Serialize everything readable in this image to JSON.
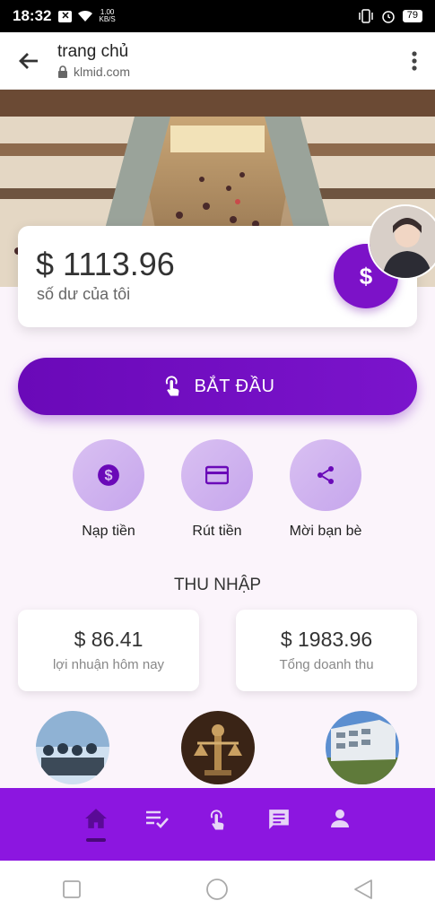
{
  "status_bar": {
    "time": "18:32",
    "speed_value": "1.00",
    "speed_unit": "KB/S",
    "battery": "79"
  },
  "browser": {
    "title": "trang chủ",
    "url": "klmid.com"
  },
  "balance": {
    "amount": "$ 1113.96",
    "label": "số dư của tôi",
    "fab_symbol": "$"
  },
  "start_button": {
    "label": "BẮT ĐẦU"
  },
  "actions": [
    {
      "label": "Nạp tiền",
      "icon": "dollar-circle-icon"
    },
    {
      "label": "Rút tiền",
      "icon": "credit-card-icon"
    },
    {
      "label": "Mời bạn bè",
      "icon": "share-icon"
    }
  ],
  "income": {
    "title": "THU NHẬP",
    "cards": [
      {
        "value": "$ 86.41",
        "label": "lợi nhuận hôm nay"
      },
      {
        "value": "$ 1983.96",
        "label": "Tổng doanh thu"
      }
    ]
  },
  "colors": {
    "primary": "#7b14cc",
    "nav": "#8c16e0",
    "circle": "#d0b4ef"
  }
}
